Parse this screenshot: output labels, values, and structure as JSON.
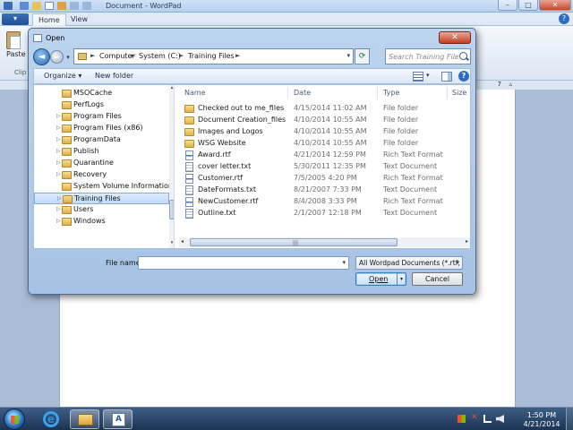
{
  "wordpad": {
    "title": "Document - WordPad",
    "tabs": [
      {
        "label": "Home"
      },
      {
        "label": "View"
      }
    ],
    "paste_label": "Paste",
    "clipboard_label": "Clip",
    "ruler_mark": "7",
    "min_glyph": "–",
    "max_glyph": "□",
    "close_glyph": "✕",
    "help_glyph": "?"
  },
  "dialog": {
    "title": "Open",
    "close_glyph": "✕",
    "address": {
      "segments": [
        "Computer",
        "System (C:)",
        "Training Files"
      ]
    },
    "search": {
      "placeholder": "Search Training Files"
    },
    "toolbar": {
      "organize": "Organize ▾",
      "new_folder": "New folder",
      "help": "?"
    },
    "nav_items": [
      {
        "label": "MSOCache",
        "expandable": false,
        "selected": false
      },
      {
        "label": "PerfLogs",
        "expandable": false,
        "selected": false
      },
      {
        "label": "Program Files",
        "expandable": true,
        "selected": false
      },
      {
        "label": "Program Files (x86)",
        "expandable": true,
        "selected": false
      },
      {
        "label": "ProgramData",
        "expandable": true,
        "selected": false
      },
      {
        "label": "Publish",
        "expandable": true,
        "selected": false
      },
      {
        "label": "Quarantine",
        "expandable": true,
        "selected": false
      },
      {
        "label": "Recovery",
        "expandable": true,
        "selected": false
      },
      {
        "label": "System Volume Information",
        "expandable": false,
        "selected": false
      },
      {
        "label": "Training Files",
        "expandable": true,
        "selected": true
      },
      {
        "label": "Users",
        "expandable": true,
        "selected": false
      },
      {
        "label": "Windows",
        "expandable": true,
        "selected": false
      }
    ],
    "columns": {
      "name": "Name",
      "date": "Date",
      "type": "Type",
      "size": "Size"
    },
    "files": [
      {
        "name": "Checked out to me_files",
        "date": "4/15/2014 11:02 AM",
        "type": "File folder",
        "icon": "folder"
      },
      {
        "name": "Document Creation_files",
        "date": "4/10/2014 10:55 AM",
        "type": "File folder",
        "icon": "folder"
      },
      {
        "name": "Images and Logos",
        "date": "4/10/2014 10:55 AM",
        "type": "File folder",
        "icon": "folder"
      },
      {
        "name": "WSG Website",
        "date": "4/10/2014 10:55 AM",
        "type": "File folder",
        "icon": "folder"
      },
      {
        "name": "Award.rtf",
        "date": "4/21/2014 12:59 PM",
        "type": "Rich Text Format",
        "icon": "rtf"
      },
      {
        "name": "cover letter.txt",
        "date": "5/30/2011 12:35 PM",
        "type": "Text Document",
        "icon": "txt"
      },
      {
        "name": "Customer.rtf",
        "date": "7/5/2005 4:20 PM",
        "type": "Rich Text Format",
        "icon": "rtf"
      },
      {
        "name": "DateFormats.txt",
        "date": "8/21/2007 7:33 PM",
        "type": "Text Document",
        "icon": "txt"
      },
      {
        "name": "NewCustomer.rtf",
        "date": "8/4/2008 3:33 PM",
        "type": "Rich Text Format",
        "icon": "rtf"
      },
      {
        "name": "Outline.txt",
        "date": "2/1/2007 12:18 PM",
        "type": "Text Document",
        "icon": "txt"
      }
    ],
    "file_name": {
      "label": "File name:",
      "value": ""
    },
    "file_type": "All Wordpad Documents (*.rtf, ",
    "open_label": "Open",
    "cancel_label": "Cancel"
  },
  "taskbar": {
    "time": "1:50 PM",
    "date": "4/21/2014"
  }
}
